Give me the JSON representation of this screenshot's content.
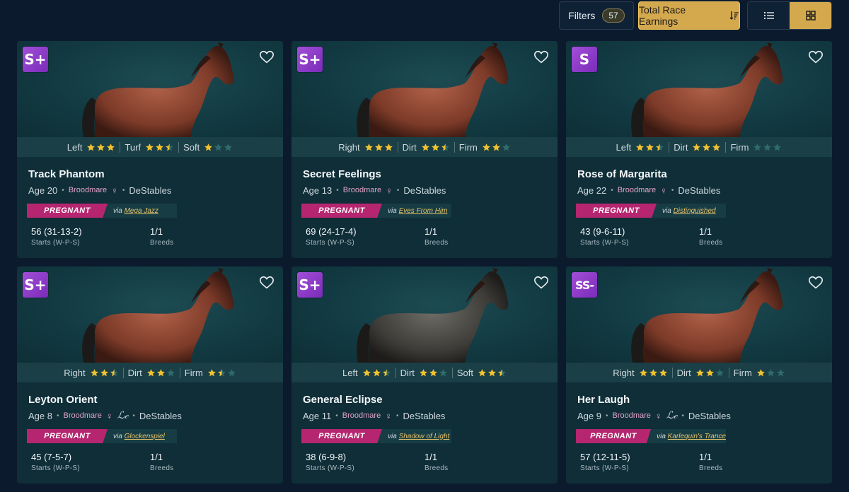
{
  "toolbar": {
    "filters_label": "Filters",
    "filters_count": "57",
    "sort_label": "Total Race Earnings",
    "view_modes": [
      "list",
      "grid"
    ],
    "active_view": "grid"
  },
  "colors": {
    "accent_gold": "#d4a94e",
    "pregnant_tag": "#b62670",
    "grade_purple": "#9a45d0",
    "star_filled": "#f2c230",
    "star_empty": "#2f6b6b"
  },
  "horses": [
    {
      "grade": "S+",
      "name": "Track Phantom",
      "age": "Age 20",
      "role": "Broodmare",
      "lc": false,
      "stable": "DeStables",
      "stats": [
        {
          "label": "Left",
          "stars": 3
        },
        {
          "label": "Turf",
          "stars": 2.5
        },
        {
          "label": "Soft",
          "stars": 1
        }
      ],
      "status": "PREGNANT",
      "via_prefix": "via",
      "via_name": "Mega Jazz",
      "record": "56 (31-13-2)",
      "record_label": "Starts (W-P-S)",
      "breeds": "1/1",
      "breeds_label": "Breeds",
      "coat": "bay"
    },
    {
      "grade": "S+",
      "name": "Secret Feelings",
      "age": "Age 13",
      "role": "Broodmare",
      "lc": false,
      "stable": "DeStables",
      "stats": [
        {
          "label": "Right",
          "stars": 3
        },
        {
          "label": "Dirt",
          "stars": 2.5
        },
        {
          "label": "Firm",
          "stars": 2
        }
      ],
      "status": "PREGNANT",
      "via_prefix": "via",
      "via_name": "Eyes From Him",
      "record": "69 (24-17-4)",
      "record_label": "Starts (W-P-S)",
      "breeds": "1/1",
      "breeds_label": "Breeds",
      "coat": "bay"
    },
    {
      "grade": "S",
      "name": "Rose of Margarita",
      "age": "Age 22",
      "role": "Broodmare",
      "lc": false,
      "stable": "DeStables",
      "stats": [
        {
          "label": "Left",
          "stars": 2.5
        },
        {
          "label": "Dirt",
          "stars": 3
        },
        {
          "label": "Firm",
          "stars": 0
        }
      ],
      "status": "PREGNANT",
      "via_prefix": "via",
      "via_name": "Distinguished",
      "record": "43 (9-6-11)",
      "record_label": "Starts (W-P-S)",
      "breeds": "1/1",
      "breeds_label": "Breeds",
      "coat": "bay"
    },
    {
      "grade": "S+",
      "name": "Leyton Orient",
      "age": "Age 8",
      "role": "Broodmare",
      "lc": true,
      "stable": "DeStables",
      "stats": [
        {
          "label": "Right",
          "stars": 2.5
        },
        {
          "label": "Dirt",
          "stars": 2
        },
        {
          "label": "Firm",
          "stars": 1.5
        }
      ],
      "status": "PREGNANT",
      "via_prefix": "via",
      "via_name": "Glockenspiel",
      "record": "45 (7-5-7)",
      "record_label": "Starts (W-P-S)",
      "breeds": "1/1",
      "breeds_label": "Breeds",
      "coat": "bay"
    },
    {
      "grade": "S+",
      "name": "General Eclipse",
      "age": "Age 11",
      "role": "Broodmare",
      "lc": false,
      "stable": "DeStables",
      "stats": [
        {
          "label": "Left",
          "stars": 2.5
        },
        {
          "label": "Dirt",
          "stars": 2
        },
        {
          "label": "Soft",
          "stars": 2.5
        }
      ],
      "status": "PREGNANT",
      "via_prefix": "via",
      "via_name": "Shadow of Light",
      "record": "38 (6-9-8)",
      "record_label": "Starts (W-P-S)",
      "breeds": "1/1",
      "breeds_label": "Breeds",
      "coat": "dark"
    },
    {
      "grade": "SS-",
      "name": "Her Laugh",
      "age": "Age 9",
      "role": "Broodmare",
      "lc": true,
      "stable": "DeStables",
      "stats": [
        {
          "label": "Right",
          "stars": 3
        },
        {
          "label": "Dirt",
          "stars": 2
        },
        {
          "label": "Firm",
          "stars": 1
        }
      ],
      "status": "PREGNANT",
      "via_prefix": "via",
      "via_name": "Karlequin's Trance",
      "record": "57 (12-11-5)",
      "record_label": "Starts (W-P-S)",
      "breeds": "1/1",
      "breeds_label": "Breeds",
      "coat": "bay"
    }
  ]
}
